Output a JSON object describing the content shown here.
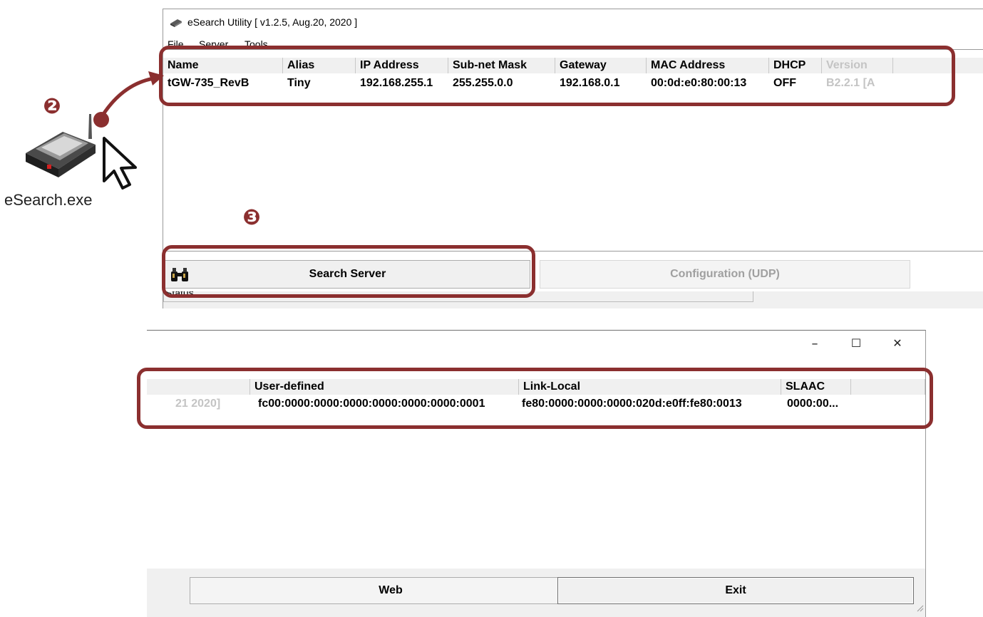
{
  "top_window": {
    "title": "eSearch Utility [ v1.2.5, Aug.20, 2020 ]",
    "menu": [
      "File",
      "Server",
      "Tools"
    ],
    "columns": [
      "Name",
      "Alias",
      "IP Address",
      "Sub-net Mask",
      "Gateway",
      "MAC Address",
      "DHCP",
      "Version"
    ],
    "row": [
      "tGW-735_RevB",
      "Tiny",
      "192.168.255.1",
      "255.255.0.0",
      "192.168.0.1",
      "00:0d:e0:80:00:13",
      "OFF",
      "B2.2.1 [A"
    ],
    "search_button": "Search Server",
    "config_button": "Configuration (UDP)",
    "status_label": "Status"
  },
  "bottom_window": {
    "controls": {
      "minimize": "–",
      "maximize": "☐",
      "close": "✕"
    },
    "columns": [
      "",
      "User-defined",
      "Link-Local",
      "SLAAC",
      ""
    ],
    "row": [
      "21 2020]",
      "fc00:0000:0000:0000:0000:0000:0000:0001",
      "fe80:0000:0000:0000:020d:e0ff:fe80:0013",
      "0000:00...",
      ""
    ],
    "web_button": "Web",
    "exit_button": "Exit"
  },
  "desktop": {
    "icon_label": "eSearch.exe"
  },
  "steps": {
    "step2": "❷",
    "step3": "❸"
  },
  "colors": {
    "callout": "#8b2f2f",
    "window_bg": "#ffffff",
    "button_bg": "#f0f0f0"
  }
}
